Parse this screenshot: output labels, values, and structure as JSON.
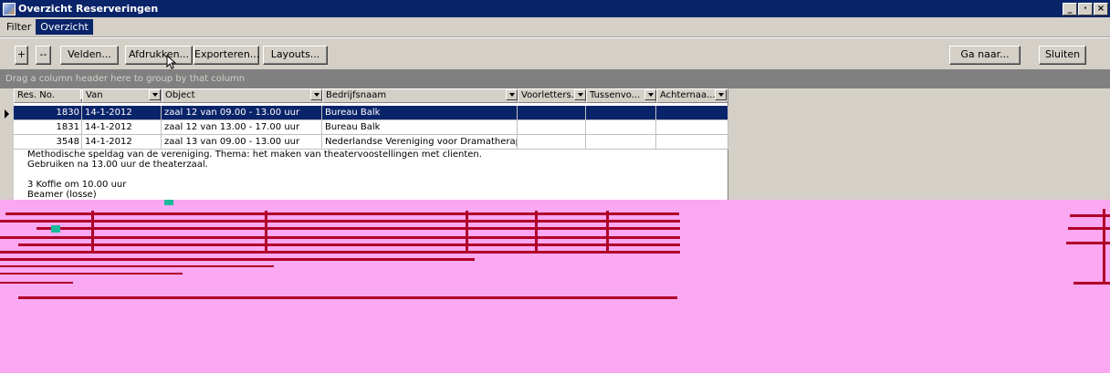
{
  "window": {
    "title": "Overzicht Reserveringen",
    "buttons": [
      "_",
      "·",
      "×"
    ]
  },
  "menu": {
    "items": [
      {
        "label": "Filter"
      },
      {
        "label": "Overzicht"
      }
    ]
  },
  "toolbar": {
    "plus": "+",
    "minus": "--",
    "velden": "Velden...",
    "afdrukken": "Afdrukken...",
    "exporteren": "Exporteren...",
    "layouts": "Layouts...",
    "ganaar": "Ga naar...",
    "sluiten": "Sluiten"
  },
  "grid": {
    "group_hint": "Drag a column header here to group by that column",
    "columns": [
      "Res. No.",
      "Van",
      "Object",
      "Bedrijfsnaam",
      "Voorletters...",
      "Tussenvo...",
      "Achternaa..."
    ],
    "rows": [
      {
        "resno": "1830",
        "van": "14-1-2012",
        "object": "zaal 12 van 09.00 - 13.00 uur",
        "bedrijf": "Bureau Balk"
      },
      {
        "resno": "1831",
        "van": "14-1-2012",
        "object": "zaal 12 van 13.00 - 17.00 uur",
        "bedrijf": "Bureau Balk"
      },
      {
        "resno": "3548",
        "van": "14-1-2012",
        "object": "zaal 13 van 09.00 - 13.00 uur",
        "bedrijf": "Nederlandse Vereniging voor Dramatherapie"
      }
    ],
    "detail": {
      "line1": "Methodische speldag van de vereniging. Thema: het maken van theatervoostellingen met clienten.",
      "line2": "Gebruiken na 13.00 uur de theaterzaal.",
      "line3": "3 Koffie om 10.00 uur",
      "line4": "Beamer (losse)"
    }
  },
  "colors": {
    "titlebar": "#0a246a",
    "face": "#d4d0c8",
    "overlay": "#f9a8f1",
    "artifact": "#b0002a"
  }
}
